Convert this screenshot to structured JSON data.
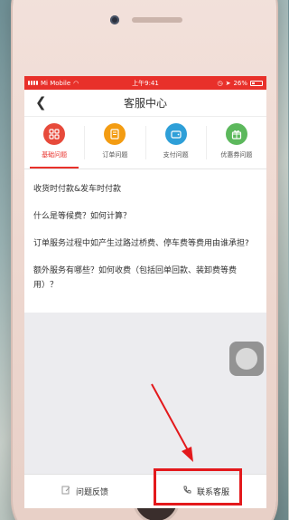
{
  "status_bar": {
    "carrier": "Mi Mobile",
    "time": "上午9:41",
    "battery": "26%"
  },
  "header": {
    "title": "客服中心",
    "back_icon": "chevron-left-icon"
  },
  "tabs": [
    {
      "label": "基础问题",
      "icon": "grid-icon",
      "color": "#e74a3b",
      "active": true
    },
    {
      "label": "订单问题",
      "icon": "document-icon",
      "color": "#f39c12",
      "active": false
    },
    {
      "label": "支付问题",
      "icon": "wallet-icon",
      "color": "#2e9fd8",
      "active": false
    },
    {
      "label": "优惠券问题",
      "icon": "gift-icon",
      "color": "#5cb85c",
      "active": false
    }
  ],
  "questions": [
    "收货时付款&发车时付款",
    "什么是等候费？如何计算？",
    "订单服务过程中如产生过路过桥费、停车费等费用由谁承担?",
    "额外服务有哪些？如何收费（包括回单回款、装卸费等费用）？"
  ],
  "bottom_bar": {
    "feedback_label": "问题反馈",
    "feedback_icon": "edit-icon",
    "contact_label": "联系客服",
    "contact_icon": "phone-icon"
  },
  "annotation": {
    "color": "#e3191c"
  }
}
